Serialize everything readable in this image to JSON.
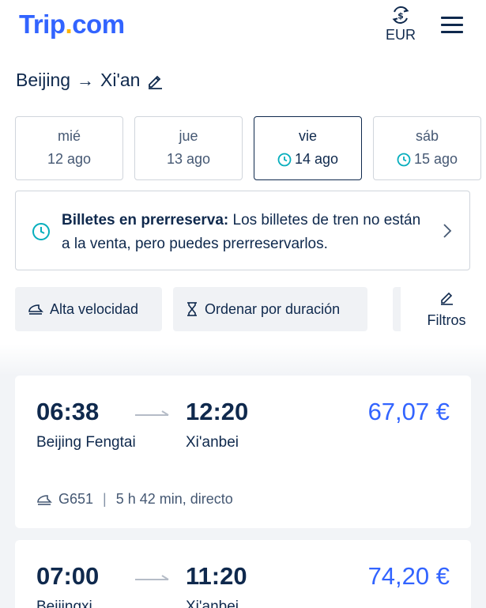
{
  "header": {
    "logo_main": "Trip",
    "logo_dot": ".",
    "logo_suffix": "com",
    "currency": "EUR"
  },
  "route": {
    "from": "Beijing",
    "arrow": "→",
    "to": "Xi'an"
  },
  "dates": [
    {
      "dow": "mié",
      "date": "12 ago",
      "selected": false,
      "clock": false
    },
    {
      "dow": "jue",
      "date": "13 ago",
      "selected": false,
      "clock": false
    },
    {
      "dow": "vie",
      "date": "14 ago",
      "selected": true,
      "clock": true
    },
    {
      "dow": "sáb",
      "date": "15 ago",
      "selected": false,
      "clock": true
    }
  ],
  "banner": {
    "bold": "Billetes en prerreserva:",
    "text": " Los billetes de tren no están a la venta, pero puedes prerreservarlos."
  },
  "filters": {
    "high_speed": "Alta velocidad",
    "sort_duration": "Ordenar por duración",
    "filters": "Filtros"
  },
  "results": [
    {
      "departure": "06:38",
      "arrival": "12:20",
      "price": "67,07 €",
      "from_station": "Beijing Fengtai",
      "to_station": "Xi'anbei",
      "train": "G651",
      "separator": "|",
      "duration": "5 h 42 min, directo"
    },
    {
      "departure": "07:00",
      "arrival": "11:20",
      "price": "74,20 €",
      "from_station": "Beijingxi",
      "to_station": "Xi'anbei"
    }
  ],
  "colors": {
    "brand_blue": "#3264ff",
    "brand_yellow": "#ffb400",
    "text_dark": "#0f294d",
    "clock_green": "#06aebd"
  }
}
